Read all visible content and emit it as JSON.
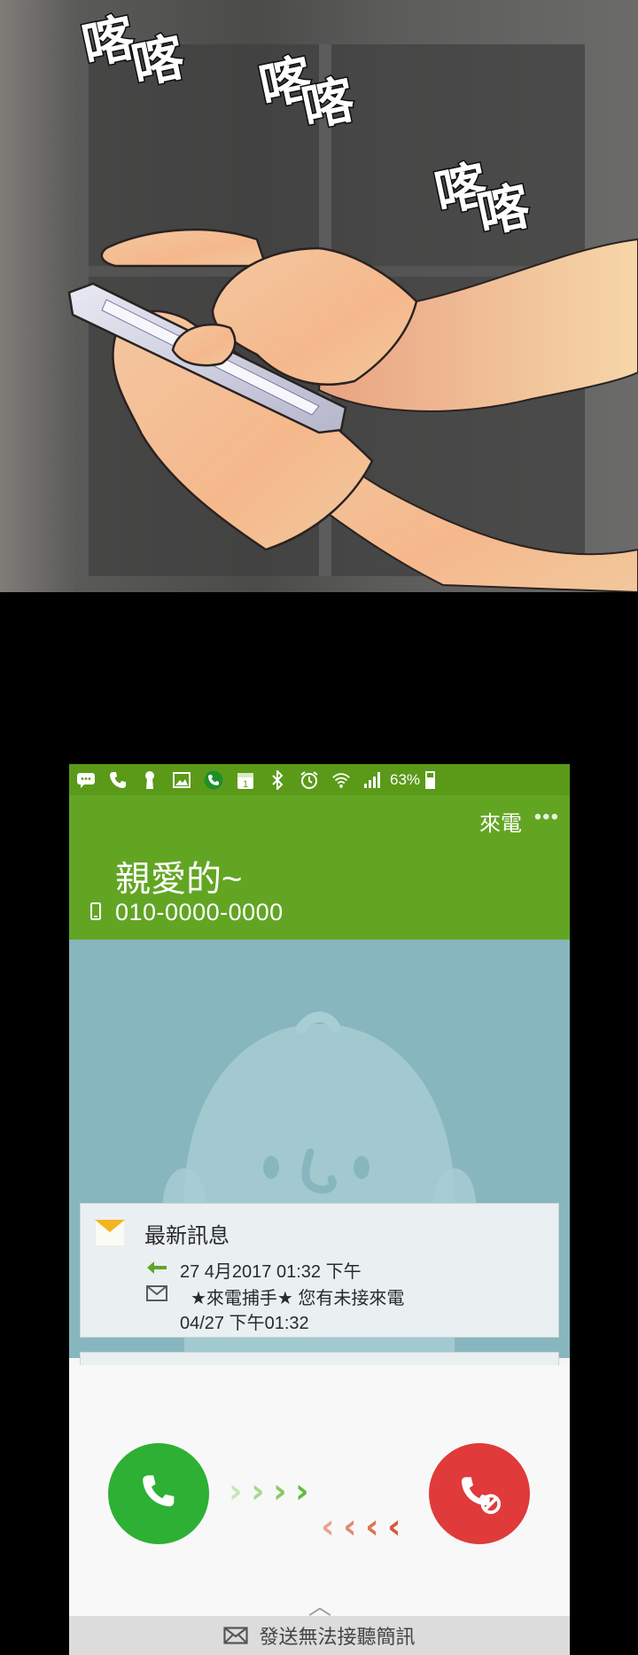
{
  "comic": {
    "sfx": [
      "喀",
      "喀",
      "喀"
    ]
  },
  "status_bar": {
    "icons": [
      "message-icon",
      "phone-icon",
      "keyhole-icon",
      "image-icon",
      "call-app-icon",
      "calendar-icon",
      "bluetooth-icon",
      "alarm-icon",
      "wifi-icon",
      "signal-icon",
      "battery-icon"
    ],
    "battery_percent": "63%",
    "battery_level": 0.63
  },
  "call": {
    "incoming_label": "來電",
    "caller_name": "親愛的~",
    "caller_number": "010-0000-0000"
  },
  "message_card": {
    "title": "最新訊息",
    "reply_line": "27 4月2017 01:32 下午",
    "message_line": "★來電捕手★  您有未接來電",
    "message_time": "04/27 下午01:32"
  },
  "actions": {
    "accept_icon": "phone-accept-icon",
    "reject_icon": "phone-reject-icon",
    "sms_label": "發送無法接聽簡訊"
  },
  "colors": {
    "header_green": "#62a523",
    "accept_green": "#2db034",
    "reject_red": "#e03a3a",
    "avatar_bg": "#88b6be"
  }
}
